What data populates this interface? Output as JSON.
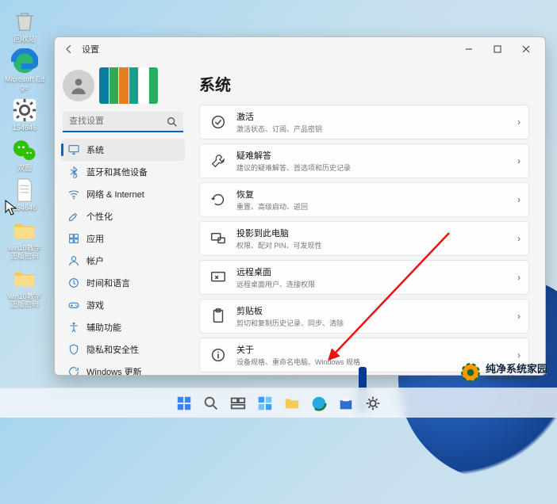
{
  "desktop": {
    "icons": [
      {
        "id": "recycle-bin",
        "label": "回收站"
      },
      {
        "id": "edge",
        "label": "Microsoft Edge"
      },
      {
        "id": "sys-154646-1",
        "label": "154646"
      },
      {
        "id": "wechat",
        "label": "双图"
      },
      {
        "id": "doc-154646",
        "label": "154646"
      },
      {
        "id": "folder-tutorial-1",
        "label": "win10教学正版密码"
      },
      {
        "id": "folder-tutorial-2",
        "label": "win10教学正版密码"
      }
    ]
  },
  "window": {
    "title": "设置",
    "search_placeholder": "查找设置",
    "nav": [
      {
        "id": "system",
        "label": "系统",
        "active": true
      },
      {
        "id": "bluetooth",
        "label": "蓝牙和其他设备"
      },
      {
        "id": "network",
        "label": "网络 & Internet"
      },
      {
        "id": "personalization",
        "label": "个性化"
      },
      {
        "id": "apps",
        "label": "应用"
      },
      {
        "id": "accounts",
        "label": "帐户"
      },
      {
        "id": "time-language",
        "label": "时间和语言"
      },
      {
        "id": "gaming",
        "label": "游戏"
      },
      {
        "id": "accessibility",
        "label": "辅助功能"
      },
      {
        "id": "privacy",
        "label": "隐私和安全性"
      },
      {
        "id": "update",
        "label": "Windows 更新"
      }
    ],
    "page": {
      "title": "系统",
      "tiles": [
        {
          "id": "activation",
          "title": "激活",
          "sub": "激活状态、订阅、产品密钥"
        },
        {
          "id": "troubleshoot",
          "title": "疑难解答",
          "sub": "建议的疑难解答、首选项和历史记录"
        },
        {
          "id": "recovery",
          "title": "恢复",
          "sub": "重置、高级启动、返回"
        },
        {
          "id": "projecting",
          "title": "投影到此电脑",
          "sub": "权限、配对 PIN、可发现性"
        },
        {
          "id": "remote-desktop",
          "title": "远程桌面",
          "sub": "远程桌面用户、连接权限"
        },
        {
          "id": "clipboard",
          "title": "剪贴板",
          "sub": "剪切和复制历史记录、同步、清除"
        },
        {
          "id": "about",
          "title": "关于",
          "sub": "设备规格、重命名电脑、Windows 规格"
        }
      ]
    }
  },
  "watermark": {
    "brand": "纯净系统家园",
    "url": "www.yidaimei.com"
  }
}
